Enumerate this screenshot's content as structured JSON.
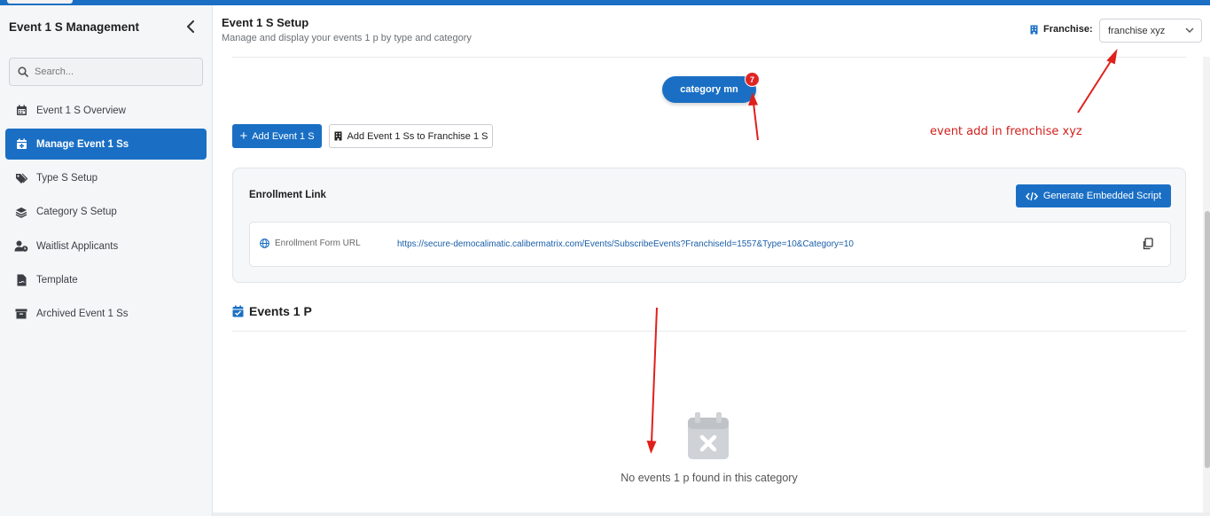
{
  "sidebar": {
    "title": "Event 1 S Management",
    "search_placeholder": "Search...",
    "items": [
      {
        "label": "Event 1 S Overview",
        "icon": "calendar-icon",
        "active": false
      },
      {
        "label": "Manage Event 1 Ss",
        "icon": "calendar-plus-icon",
        "active": true
      },
      {
        "label": "Type S Setup",
        "icon": "tags-icon",
        "active": false
      },
      {
        "label": "Category S Setup",
        "icon": "layers-icon",
        "active": false
      },
      {
        "label": "Waitlist Applicants",
        "icon": "user-clock-icon",
        "active": false
      },
      {
        "label": "Template",
        "icon": "file-signature-icon",
        "active": false
      },
      {
        "label": "Archived Event 1 Ss",
        "icon": "archive-icon",
        "active": false
      }
    ]
  },
  "header": {
    "title": "Event 1 S Setup",
    "subtitle": "Manage and display your events 1 p by type and category",
    "franchise_label": "Franchise:",
    "franchise_selected": "franchise xyz"
  },
  "category_pill": {
    "label": "category mn",
    "badge": "7"
  },
  "actions": {
    "add_event": "Add Event 1 S",
    "add_to_franchise": "Add Event 1 Ss to Franchise 1 S"
  },
  "annotation": {
    "text": "event add in frenchise xyz",
    "color": "#d0211d"
  },
  "enrollment": {
    "title": "Enrollment Link",
    "embed_button": "Generate Embedded Script",
    "url_label": "Enrollment Form URL",
    "url": "https://secure-democalimatic.calibermatrix.com/Events/SubscribeEvents?FranchiseId=1557&Type=10&Category=10"
  },
  "events": {
    "title": "Events 1 P",
    "empty_message": "No events 1 p found in this category"
  },
  "colors": {
    "accent": "#1a6fc4",
    "badge": "#e02424"
  }
}
